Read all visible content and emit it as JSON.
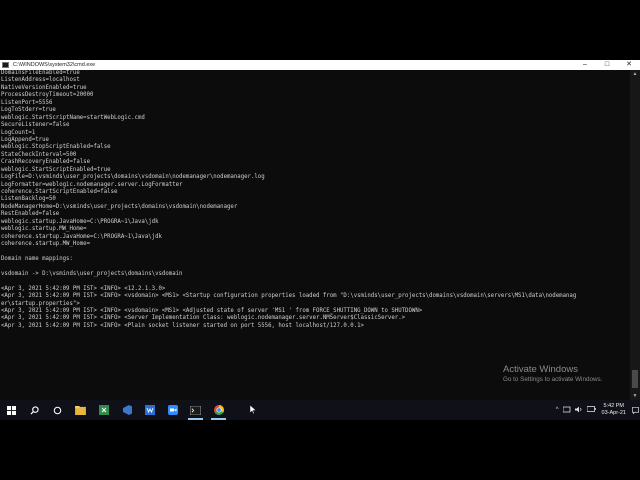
{
  "window": {
    "title": "C:\\WINDOWS\\system32\\cmd.exe",
    "controls": {
      "minimize": "–",
      "maximize": "□",
      "close": "✕"
    }
  },
  "console": {
    "lines": [
      "DomainsFileEnabled=true",
      "ListenAddress=localhost",
      "NativeVersionEnabled=true",
      "ProcessDestroyTimeout=20000",
      "ListenPort=5556",
      "LogToStderr=true",
      "weblogic.StartScriptName=startWebLogic.cmd",
      "SecureListener=false",
      "LogCount=1",
      "LogAppend=true",
      "weblogic.StopScriptEnabled=false",
      "StateCheckInterval=500",
      "CrashRecoveryEnabled=false",
      "weblogic.StartScriptEnabled=true",
      "LogFile=D:\\vsminds\\user_projects\\domains\\vsdomain\\nodemanager\\nodemanager.log",
      "LogFormatter=weblogic.nodemanager.server.LogFormatter",
      "coherence.StartScriptEnabled=false",
      "ListenBacklog=50",
      "NodeManagerHome=D:\\vsminds\\user_projects\\domains\\vsdomain\\nodemanager",
      "RestEnabled=false",
      "weblogic.startup.JavaHome=C:\\PROGRA~1\\Java\\jdk",
      "weblogic.startup.MW_Home=",
      "coherence.startup.JavaHome=C:\\PROGRA~1\\Java\\jdk",
      "coherence.startup.MW_Home=",
      "",
      "Domain name mappings:",
      "",
      "vsdomain -> D:\\vsminds\\user_projects\\domains\\vsdomain",
      "",
      "<Apr 3, 2021 5:42:09 PM IST> <INFO> <12.2.1.3.0>",
      "<Apr 3, 2021 5:42:09 PM IST> <INFO> <vsdomain> <MS1> <Startup configuration properties loaded from \"D:\\vsminds\\user_projects\\domains\\vsdomain\\servers\\MS1\\data\\nodemanag",
      "er\\startup.properties\">",
      "<Apr 3, 2021 5:42:09 PM IST> <INFO> <vsdomain> <MS1> <Adjusted state of server 'MS1 ' from FORCE_SHUTTING_DOWN to SHUTDOWN>",
      "<Apr 3, 2021 5:42:09 PM IST> <INFO> <Server Implementation Class: weblogic.nodemanager.server.NMServer$ClassicServer.>",
      "<Apr 3, 2021 5:42:09 PM IST> <INFO> <Plain socket listener started on port 5556, host localhost/127.0.0.1>"
    ]
  },
  "watermark": {
    "title": "Activate Windows",
    "subtitle": "Go to Settings to activate Windows."
  },
  "taskbar": {
    "apps": [
      {
        "name": "start-icon",
        "color": "#ffffff"
      },
      {
        "name": "search-icon",
        "color": "#ffffff"
      },
      {
        "name": "task-view-icon",
        "color": "#ffffff"
      },
      {
        "name": "file-explorer-icon",
        "color": "#e8b73a"
      },
      {
        "name": "excel-icon",
        "color": "#2e8b4a"
      },
      {
        "name": "vs-icon",
        "color": "#3a78c9"
      },
      {
        "name": "word-icon",
        "color": "#2b6fd6"
      },
      {
        "name": "zoom-icon",
        "color": "#2d8cff"
      },
      {
        "name": "cmd-icon",
        "color": "#1a1a1a"
      },
      {
        "name": "chrome-icon",
        "color": "#dd4b39"
      }
    ],
    "tray": {
      "chevron": "^",
      "time": "5:42 PM",
      "date": "03-Apr-21"
    }
  }
}
